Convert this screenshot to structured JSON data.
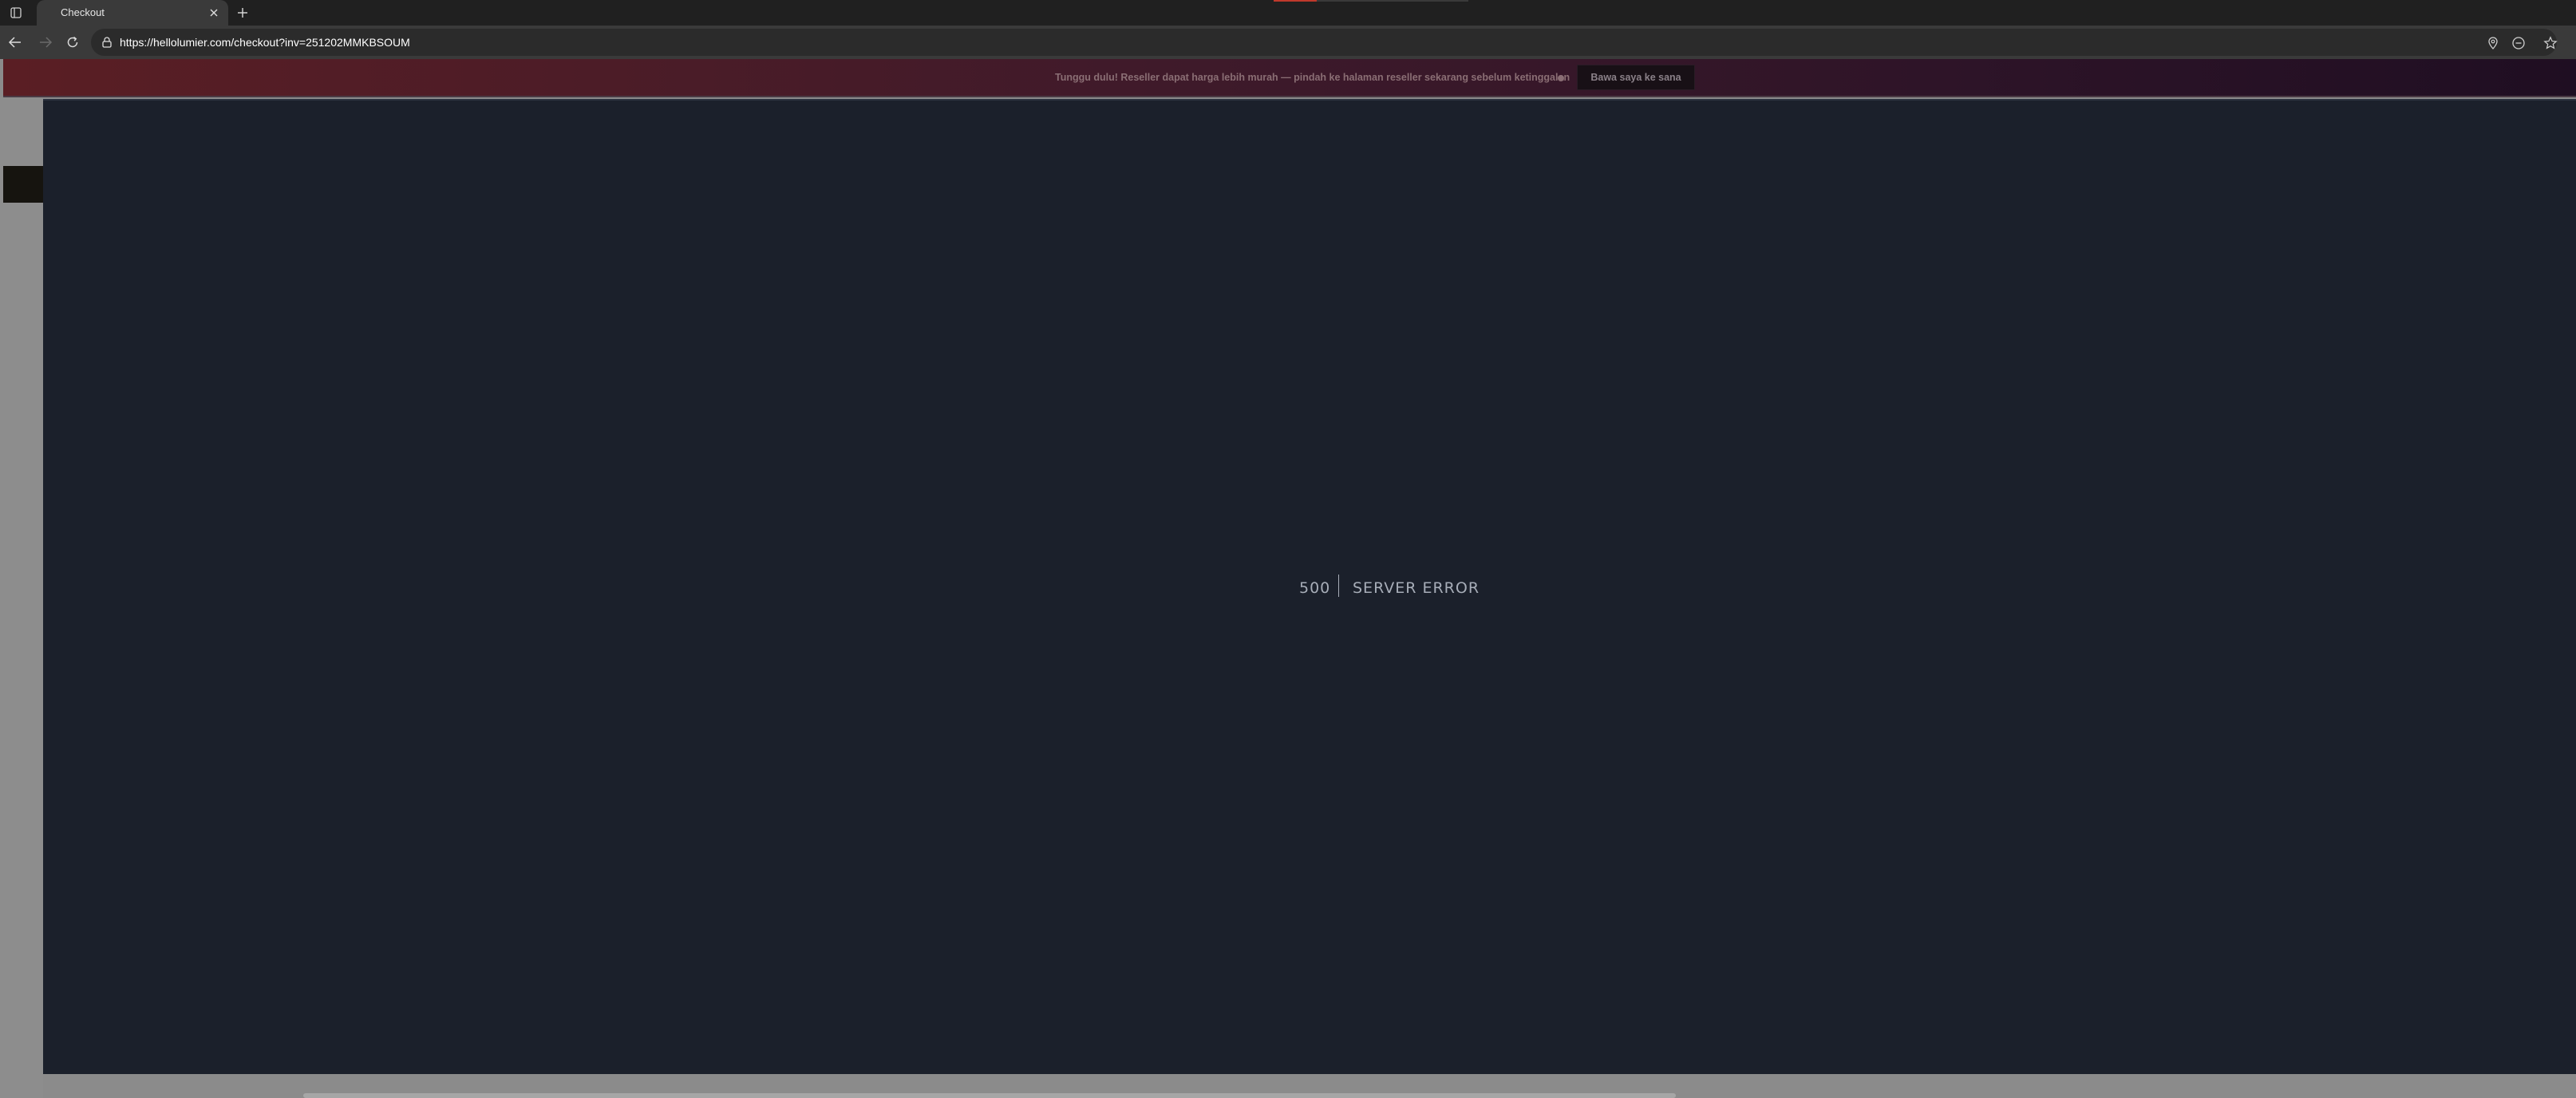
{
  "browser": {
    "tab": {
      "title": "Checkout",
      "close_icon": "close-icon"
    },
    "icons": {
      "tab_actions": "tab-actions-icon",
      "new_tab": "plus-icon",
      "back": "arrow-left-icon",
      "forward": "arrow-right-icon",
      "reload": "reload-icon",
      "lock": "lock-icon",
      "location": "location-pin-icon",
      "reader": "reader-icon",
      "favorite": "star-icon"
    },
    "address_bar": {
      "url": "https://hellolumier.com/checkout?inv=251202MMKBSOUM"
    }
  },
  "promo": {
    "text": "Tunggu dulu! Reseller dapat harga lebih murah — pindah ke halaman reseller sekarang sebelum ketinggalan",
    "button_label": "Bawa saya ke sana"
  },
  "error": {
    "code": "500",
    "message": "SERVER ERROR"
  },
  "colors": {
    "chrome_bg": "#202020",
    "toolbar_bg": "#3a3a3a",
    "error_panel_bg": "#1b202b",
    "error_text": "#a7adb8",
    "promo_start": "#5a1e24",
    "promo_end": "#1f0e22"
  }
}
